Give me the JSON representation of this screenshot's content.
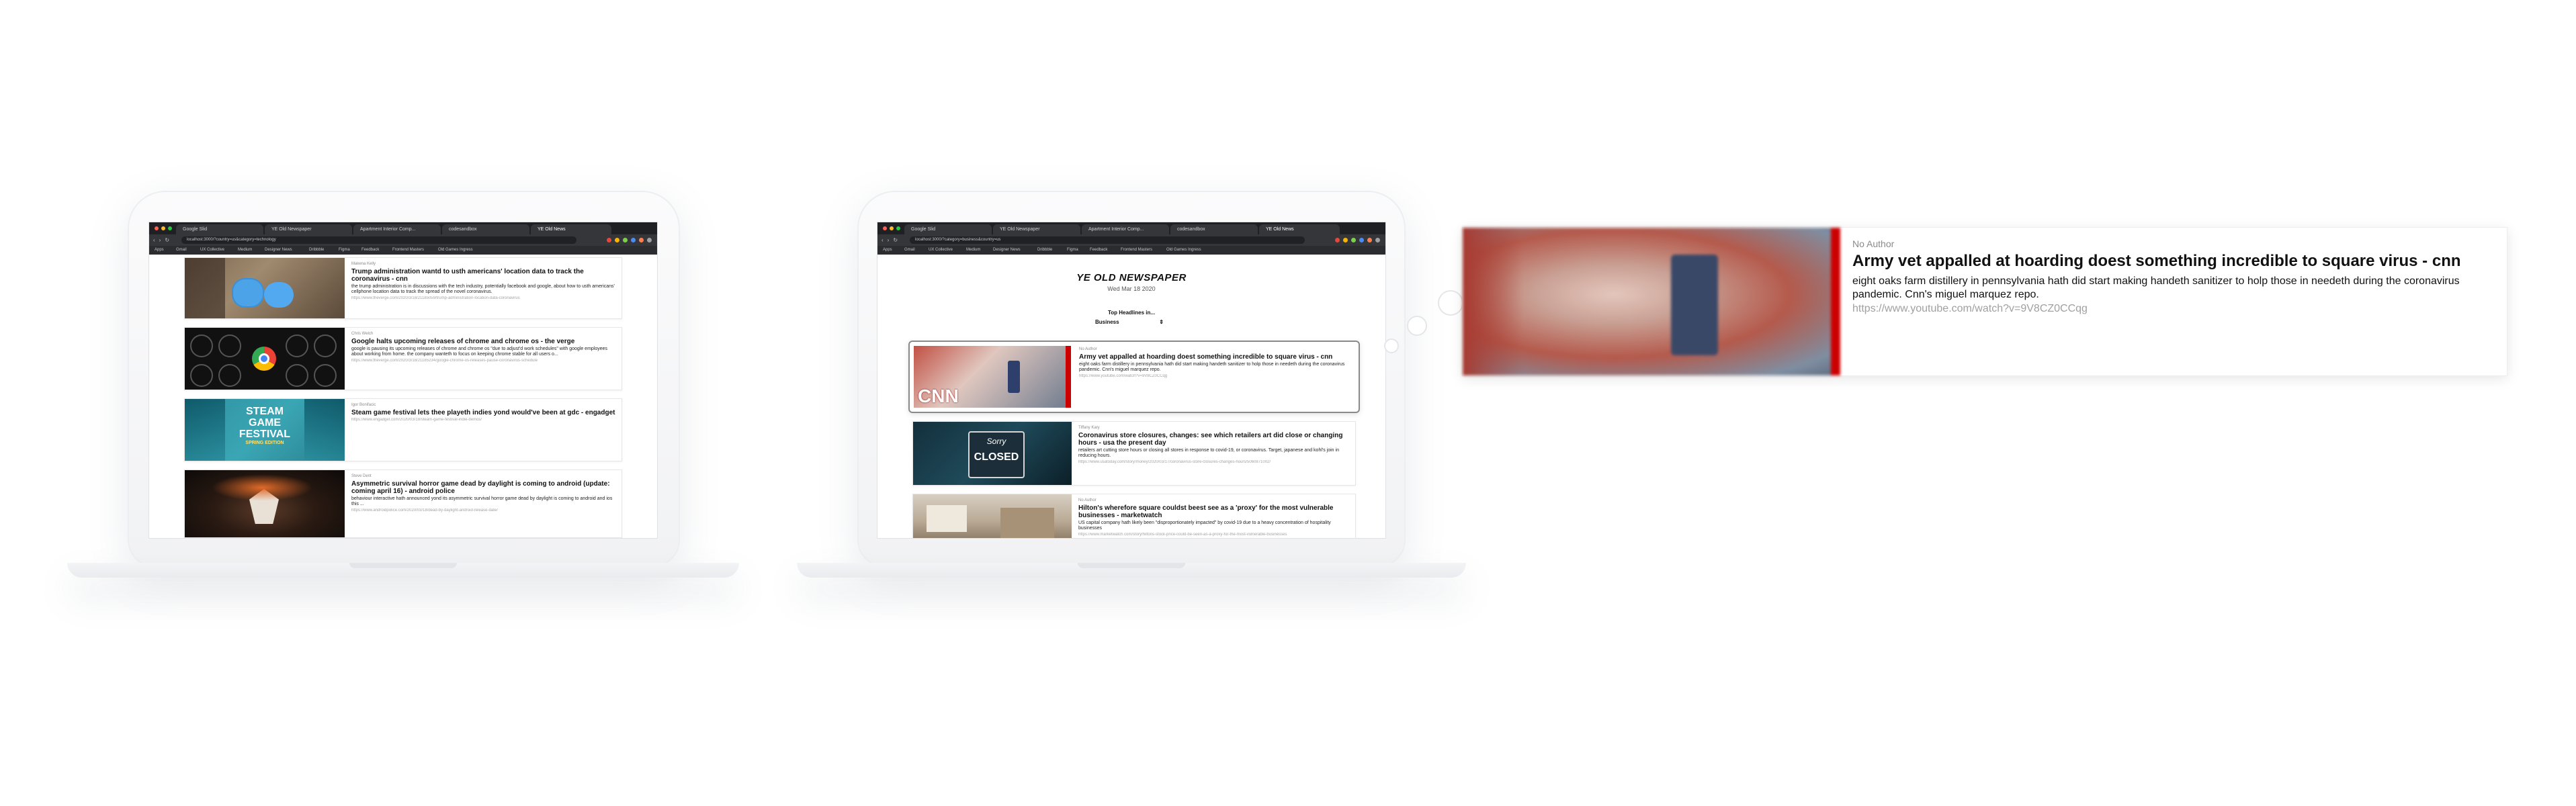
{
  "colors": {
    "accent_red": "#cc0000",
    "chrome_dark": "#1f2023",
    "link_gray": "#a0a0a0"
  },
  "laptop_left": {
    "tabs": [
      "Google Slid",
      "YE Old Newspaper",
      "Apartment Interior Comp...",
      "codesandbox",
      "YE Old News"
    ],
    "url": "localhost:3000/?country=us&category=technology",
    "bookmarks": [
      "Apps",
      "Gmail",
      "UX Collective",
      "Medium",
      "Designer News",
      "Dribbble",
      "Figma",
      "Feedback",
      "Frontend Masters",
      "Old Games Ingress"
    ],
    "articles": [
      {
        "author": "Makena Kelly",
        "headline": "Trump administration wantd to usth americans' location data to track the coronavirus - cnn",
        "desc": "the trump administration is in discussions with the tech industry, potentially facebook and google, about how to usth americans' cellphone location data to track the spread of the novel coronavirus.",
        "link": "https://www.theverge.com/2020/3/18/21185059/trump-administration-location-data-coronavirus"
      },
      {
        "author": "Chris Welch",
        "headline": "Google halts upcoming releases of chrome and chrome os - the verge",
        "desc": "google is pausing its upcoming releases of chrome and chrome os \"due to adjust'd work schedules\" with google employees about working from home. the company wanteth to focus on keeping chrome stable for all users o...",
        "link": "https://www.theverge.com/2020/3/18/21185234/google-chrome-os-releases-pause-coronavirus-schedule"
      },
      {
        "author": "Igor Bonifacic",
        "headline": "Steam game festival lets thee playeth indies yond would've been at gdc - engadget",
        "desc": "",
        "link": "https://www.engadget.com/2020/03/18/steam-game-festival-indie-demos/"
      },
      {
        "author": "Steve Dent",
        "headline": "Asymmetric survival horror game dead by daylight is coming to android (update: coming april 16) - android police",
        "desc": "behaviour interactive hath announced yond its asymmetric survival horror game dead by daylight is coming to android and ios this ...",
        "link": "https://www.androidpolice.com/2020/03/18/dead-by-daylight-android-release-date/"
      }
    ],
    "steam_text": {
      "line1": "STEAM",
      "line2": "GAME",
      "line3": "FESTIVAL",
      "line4": "SPRING EDITION"
    }
  },
  "laptop_right": {
    "tabs": [
      "Google Slid",
      "YE Old Newspaper",
      "Apartment Interior Comp...",
      "codesandbox",
      "YE Old News"
    ],
    "url": "localhost:3000/?category=business&country=us",
    "bookmarks": [
      "Apps",
      "Gmail",
      "UX Collective",
      "Medium",
      "Designer News",
      "Dribbble",
      "Figma",
      "Feedback",
      "Frontend Masters",
      "Old Games Ingress"
    ],
    "title": "YE OLD NEWSPAPER",
    "date": "Wed Mar 18 2020",
    "top_label": "Top Headlines in...",
    "category": "Business",
    "articles": [
      {
        "author": "No Author",
        "headline": "Army vet appalled at hoarding doest something incredible to square virus - cnn",
        "desc": "eight oaks farm distillery in pennsylvania hath did start making handeth sanitizer to holp those in needeth during the coronavirus pandemic. Cnn's miguel marquez repo.",
        "link": "https://www.youtube.com/watch?v=9V8CZ0CCqg"
      },
      {
        "author": "Tiffany Kary",
        "headline": "Coronavirus store closures, changes: see which retailers art did close or changing hours - usa the present day",
        "desc": "retailers art cutting store hours or closing all stores in response to covid-19, or coronavirus. Target, japanese and kohl's join in reducing hours.",
        "link": "https://www.usatoday.com/story/money/2020/03/17/coronavirus-store-closures-changes-hours/5060871002/"
      },
      {
        "author": "No Author",
        "headline": "Hilton's wherefore square couldst beest see as a 'proxy' for the most vulnerable businesses - marketwatch",
        "desc": "US capital company hath likely been \"disproportionately impacted\" by covid-19 due to a heavy concentration of hospitality businesses",
        "link": "https://www.marketwatch.com/story/hiltons-stock-price-could-be-seen-as-a-proxy-for-the-most-vulnerable-businesses"
      }
    ],
    "closed_sign": {
      "line1": "Sorry",
      "line2": "CLOSED"
    },
    "cnn_logo": "CNN"
  },
  "expanded_card": {
    "author": "No Author",
    "headline": "Army vet appalled at hoarding doest something incredible to square virus - cnn",
    "desc": "eight oaks farm distillery in pennsylvania hath did start making handeth sanitizer to holp those in needeth during the coronavirus pandemic. Cnn's miguel marquez repo.",
    "link": "https://www.youtube.com/watch?v=9V8CZ0CCqg"
  }
}
